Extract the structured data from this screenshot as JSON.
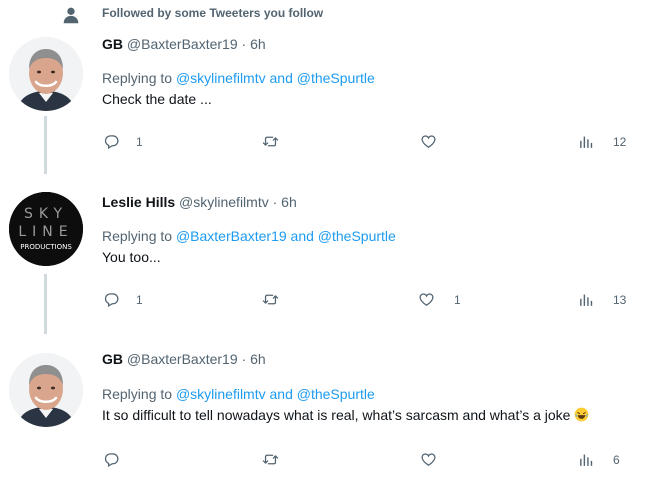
{
  "social_context": {
    "text": "Followed by some Tweeters you follow",
    "icon": "person-icon"
  },
  "tweets": [
    {
      "name": "GB",
      "handle": "@BaxterBaxter19",
      "dot": "·",
      "time": "6h",
      "replying_prefix": "Replying to",
      "mention1": "@skylinefilmtv",
      "and": "and",
      "mention2": "@theSpurtle",
      "text": "Check the date ...",
      "reply_count": "1",
      "retweet_count": "",
      "like_count": "",
      "views_count": "12"
    },
    {
      "name": "Leslie Hills",
      "handle": "@skylinefilmtv",
      "dot": "·",
      "time": "6h",
      "replying_prefix": "Replying to",
      "mention1": "@BaxterBaxter19",
      "and": "and",
      "mention2": "@theSpurtle",
      "text": "You too...",
      "avatar_lines": [
        "SKY",
        "LINE",
        "PRODUCTIONS"
      ],
      "reply_count": "1",
      "retweet_count": "",
      "like_count": "1",
      "views_count": "13"
    },
    {
      "name": "GB",
      "handle": "@BaxterBaxter19",
      "dot": "·",
      "time": "6h",
      "replying_prefix": "Replying to",
      "mention1": "@skylinefilmtv",
      "and": "and",
      "mention2": "@theSpurtle",
      "text": "It so difficult to tell nowadays what is real, what’s sarcasm and what’s a joke",
      "emoji": "face-with-tears-of-joy",
      "reply_count": "",
      "retweet_count": "",
      "like_count": "",
      "views_count": "6"
    }
  ],
  "colors": {
    "accent": "#1d9bf0",
    "secondary_text": "#536471",
    "thread_line": "#cfd9de"
  }
}
